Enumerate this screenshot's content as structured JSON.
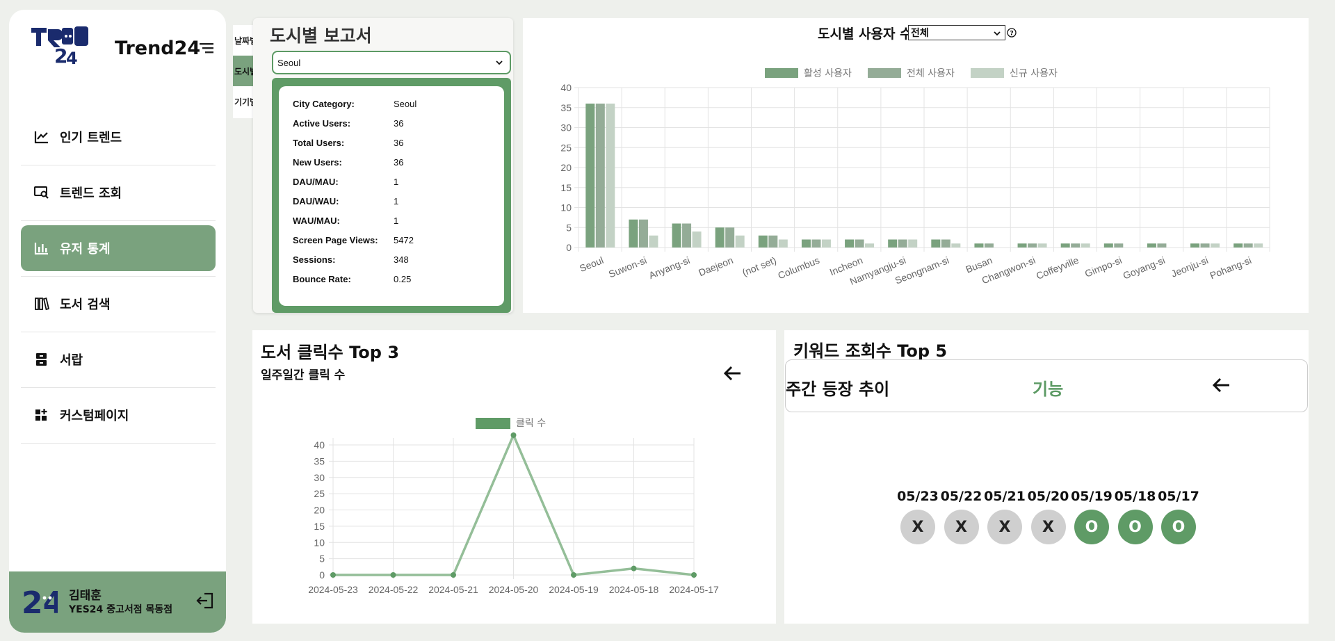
{
  "app": {
    "brand": "Trend24"
  },
  "sidebar": {
    "items": [
      {
        "label": "인기 트렌드",
        "icon": "trend-chart-icon",
        "active": false
      },
      {
        "label": "트렌드 조회",
        "icon": "search-monitor-icon",
        "active": false
      },
      {
        "label": "유저 통계",
        "icon": "bar-chart-icon",
        "active": true
      },
      {
        "label": "도서 검색",
        "icon": "books-icon",
        "active": false
      },
      {
        "label": "서랍",
        "icon": "drawer-icon",
        "active": false
      },
      {
        "label": "커스텀페이지",
        "icon": "dashboard-add-icon",
        "active": false
      }
    ],
    "user": {
      "name": "김태훈",
      "store": "YES24 중고서점 목동점"
    }
  },
  "report_tabs": [
    "날짜별",
    "도시별",
    "기기별"
  ],
  "city_report": {
    "title": "도시별 보고서",
    "selected_city": "Seoul",
    "stats": [
      {
        "label": "City Category:",
        "value": "Seoul"
      },
      {
        "label": "Active Users:",
        "value": "36"
      },
      {
        "label": "Total Users:",
        "value": "36"
      },
      {
        "label": "New Users:",
        "value": "36"
      },
      {
        "label": "DAU/MAU:",
        "value": "1"
      },
      {
        "label": "DAU/WAU:",
        "value": "1"
      },
      {
        "label": "WAU/MAU:",
        "value": "1"
      },
      {
        "label": "Screen Page Views:",
        "value": "5472"
      },
      {
        "label": "Sessions:",
        "value": "348"
      },
      {
        "label": "Bounce Rate:",
        "value": "0.25"
      }
    ]
  },
  "city_users": {
    "title": "도시별 사용자 수",
    "filter": "전체",
    "help": "?"
  },
  "book_clicks": {
    "title": "도서 클릭수 Top 3",
    "subtitle": "일주일간 클릭 수"
  },
  "keywords": {
    "title": "키워드 조회수 Top 5",
    "trend_label": "주간 등장 추이",
    "keyword": "기능",
    "days": [
      {
        "date": "05/23",
        "mark": "X"
      },
      {
        "date": "05/22",
        "mark": "X"
      },
      {
        "date": "05/21",
        "mark": "X"
      },
      {
        "date": "05/20",
        "mark": "X"
      },
      {
        "date": "05/19",
        "mark": "O"
      },
      {
        "date": "05/18",
        "mark": "O"
      },
      {
        "date": "05/17",
        "mark": "O"
      }
    ]
  },
  "colors": {
    "accent": "#7aa27e",
    "dark_accent": "#5f9b66",
    "series_total": "#94ac97",
    "series_new": "#c3d2c5",
    "line": "#94be98"
  },
  "chart_data": [
    {
      "type": "bar",
      "title": "도시별 사용자 수",
      "categories": [
        "Seoul",
        "Suwon-si",
        "Anyang-si",
        "Daejeon",
        "(not set)",
        "Columbus",
        "Incheon",
        "Namyangju-si",
        "Seongnam-si",
        "Busan",
        "Changwon-si",
        "Coffeyville",
        "Gimpo-si",
        "Goyang-si",
        "Jeonju-si",
        "Pohang-si"
      ],
      "series": [
        {
          "name": "활성 사용자",
          "values": [
            36,
            7,
            6,
            5,
            3,
            2,
            2,
            2,
            2,
            1,
            1,
            1,
            1,
            1,
            1,
            1
          ]
        },
        {
          "name": "전체 사용자",
          "values": [
            36,
            7,
            6,
            5,
            3,
            2,
            2,
            2,
            2,
            1,
            1,
            1,
            1,
            1,
            1,
            1
          ]
        },
        {
          "name": "신규 사용자",
          "values": [
            36,
            3,
            4,
            3,
            2,
            2,
            1,
            2,
            1,
            0,
            1,
            1,
            0,
            0,
            1,
            1
          ]
        }
      ],
      "ylim": [
        0,
        40
      ],
      "yticks": [
        0,
        5,
        10,
        15,
        20,
        25,
        30,
        35,
        40
      ],
      "legend": "top",
      "grid": true
    },
    {
      "type": "line",
      "x": [
        "2024-05-23",
        "2024-05-22",
        "2024-05-21",
        "2024-05-20",
        "2024-05-19",
        "2024-05-18",
        "2024-05-17"
      ],
      "series": [
        {
          "name": "클릭 수",
          "values": [
            0,
            0,
            0,
            43,
            0,
            2,
            0
          ]
        }
      ],
      "ylim": [
        0,
        40
      ],
      "yticks": [
        0,
        5,
        10,
        15,
        20,
        25,
        30,
        35,
        40
      ],
      "legend": "top",
      "grid": true
    }
  ]
}
